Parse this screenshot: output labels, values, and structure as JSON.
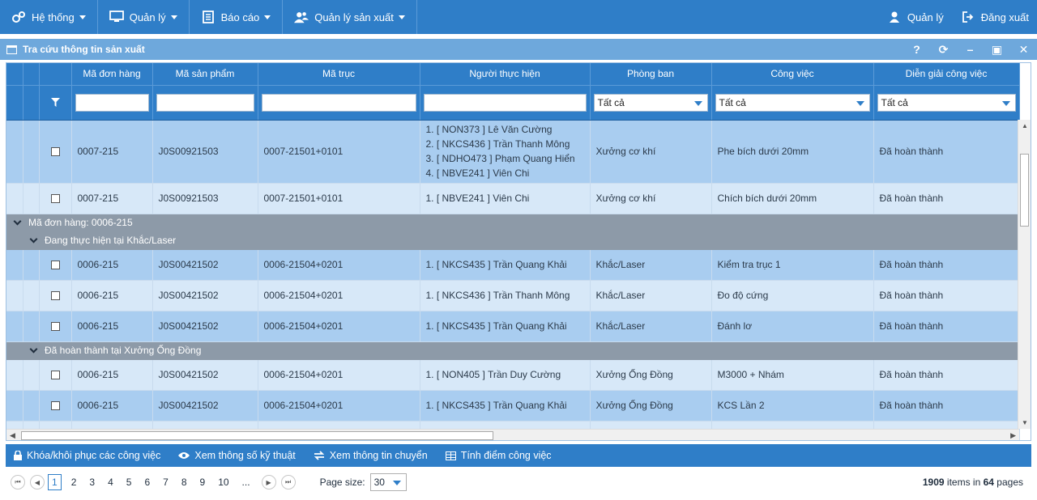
{
  "nav": {
    "items": [
      {
        "label": "Hệ thống",
        "icon": "gears-icon"
      },
      {
        "label": "Quản lý",
        "icon": "monitor-icon"
      },
      {
        "label": "Báo cáo",
        "icon": "document-icon"
      },
      {
        "label": "Quản lý sản xuất",
        "icon": "users-icon"
      }
    ],
    "user_label": "Quản lý",
    "logout_label": "Đăng xuất"
  },
  "window": {
    "title": "Tra cứu thông tin sản xuất",
    "help": "?",
    "refresh": "⟳",
    "minimize": "–",
    "maximize": "▣",
    "close": "✕"
  },
  "columns": [
    "Mã đơn hàng",
    "Mã sản phẩm",
    "Mã trục",
    "Người thực hiện",
    "Phòng ban",
    "Công việc",
    "Diễn giải công việc"
  ],
  "filters": {
    "phong_ban": "Tất cả",
    "cong_viec": "Tất cả",
    "dien_giai": "Tất cả"
  },
  "rows_top": [
    {
      "order": "0007-215",
      "product": "J0S00921503",
      "shaft": "0007-21501+0101",
      "people": [
        "1. [ NON373 ] Lê Văn Cường",
        "2. [ NKCS436 ] Trần Thanh Mông",
        "3. [ NDHO473 ] Phạm Quang Hiển",
        "4. [ NBVE241 ] Viên Chi"
      ],
      "dept": "Xưởng cơ khí",
      "task": "Phe bích dưới 20mm",
      "status": "Đã hoàn thành"
    },
    {
      "order": "0007-215",
      "product": "J0S00921503",
      "shaft": "0007-21501+0101",
      "people": [
        "1. [ NBVE241 ] Viên Chi"
      ],
      "dept": "Xưởng cơ khí",
      "task": "Chích bích dưới 20mm",
      "status": "Đã hoàn thành"
    }
  ],
  "group1": {
    "label": "Mã đơn hàng: 0006-215",
    "sub1": {
      "label": "Đang thực hiện tại Khắc/Laser",
      "rows": [
        {
          "order": "0006-215",
          "product": "J0S00421502",
          "shaft": "0006-21504+0201",
          "people": [
            "1. [ NKCS435 ] Trần Quang Khải"
          ],
          "dept": "Khắc/Laser",
          "task": "Kiểm tra trục 1",
          "status": "Đã hoàn thành"
        },
        {
          "order": "0006-215",
          "product": "J0S00421502",
          "shaft": "0006-21504+0201",
          "people": [
            "1. [ NKCS436 ] Trần Thanh Mông"
          ],
          "dept": "Khắc/Laser",
          "task": "Đo độ cứng",
          "status": "Đã hoàn thành"
        },
        {
          "order": "0006-215",
          "product": "J0S00421502",
          "shaft": "0006-21504+0201",
          "people": [
            "1. [ NKCS435 ] Trần Quang Khải"
          ],
          "dept": "Khắc/Laser",
          "task": "Đánh lơ",
          "status": "Đã hoàn thành"
        }
      ]
    },
    "sub2": {
      "label": "Đã hoàn thành tại Xưởng Ống Đồng",
      "rows": [
        {
          "order": "0006-215",
          "product": "J0S00421502",
          "shaft": "0006-21504+0201",
          "people": [
            "1. [ NON405 ] Trần Duy Cường"
          ],
          "dept": "Xưởng Ống Đồng",
          "task": "M3000 + Nhám",
          "status": "Đã hoàn thành"
        },
        {
          "order": "0006-215",
          "product": "J0S00421502",
          "shaft": "0006-21504+0201",
          "people": [
            "1. [ NKCS435 ] Trần Quang Khải"
          ],
          "dept": "Xưởng Ống Đồng",
          "task": "KCS Lần 2",
          "status": "Đã hoàn thành"
        }
      ]
    }
  },
  "actions": [
    {
      "label": "Khóa/khôi phục các công việc",
      "icon": "lock-icon"
    },
    {
      "label": "Xem thông số kỹ thuật",
      "icon": "eye-icon"
    },
    {
      "label": "Xem thông tin chuyển",
      "icon": "transfer-icon"
    },
    {
      "label": "Tính điểm công việc",
      "icon": "table-icon"
    }
  ],
  "pager": {
    "pages": [
      "1",
      "2",
      "3",
      "4",
      "5",
      "6",
      "7",
      "8",
      "9",
      "10",
      "..."
    ],
    "current": "1",
    "page_size_label": "Page size:",
    "page_size": "30",
    "total_items": "1909",
    "items_in": "items in",
    "total_pages": "64",
    "pages_label": "pages"
  },
  "colors": {
    "primary": "#2f7ec8",
    "row_dark": "#a9cdf0",
    "row_light": "#d7e8f8",
    "group": "#8d9aa8"
  }
}
